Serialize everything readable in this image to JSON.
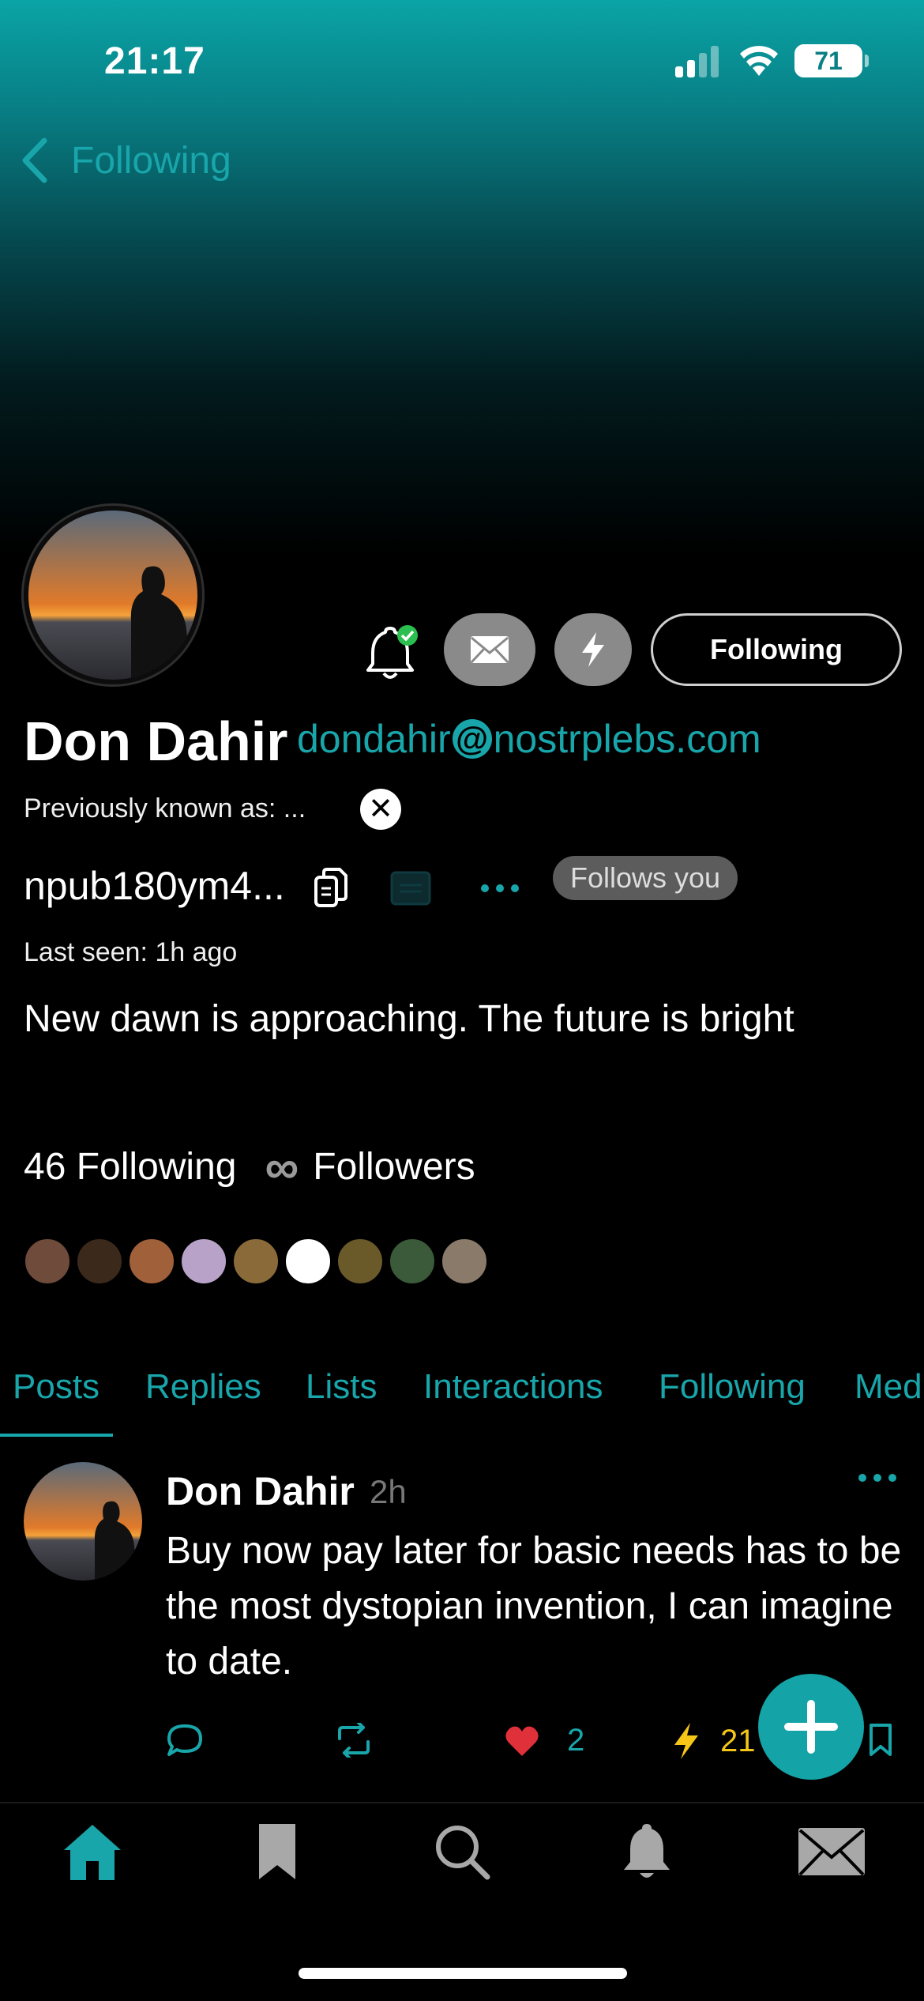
{
  "status_bar": {
    "time": "21:17",
    "battery": "71"
  },
  "nav": {
    "back_label": "Following"
  },
  "profile": {
    "name": "Don Dahir",
    "nip05_user": "dondahir",
    "nip05_at": "@",
    "nip05_domain": "nostrplebs.com",
    "previously_known": "Previously known as: ...",
    "npub": "npub180ym4...",
    "follows_you": "Follows you",
    "last_seen": "Last seen: 1h ago",
    "bio": "New dawn is approaching. The future is bright",
    "following_count": "46 Following",
    "followers_symbol": "∞",
    "followers_label": "Followers",
    "follow_button": "Following"
  },
  "mini_avatar_colors": [
    "#6e4b3a",
    "#3b2a1c",
    "#a0603a",
    "#b8a2c8",
    "#8b6a3a",
    "#ffffff",
    "#6a5a2a",
    "#3a5a3a",
    "#8a7a6a"
  ],
  "tabs": [
    "Posts",
    "Replies",
    "Lists",
    "Interactions",
    "Following",
    "Med"
  ],
  "post": {
    "author": "Don Dahir",
    "time": "2h",
    "text": "Buy now pay later for basic needs has to be the most dystopian invention, I can imagine to date.",
    "likes": "2",
    "zaps": "21"
  },
  "colors": {
    "accent": "#18a6ab",
    "like": "#e0303a",
    "zap": "#f5c518"
  },
  "bottom_nav": [
    "home-icon",
    "bookmark-icon",
    "search-icon",
    "bell-icon",
    "mail-icon"
  ]
}
